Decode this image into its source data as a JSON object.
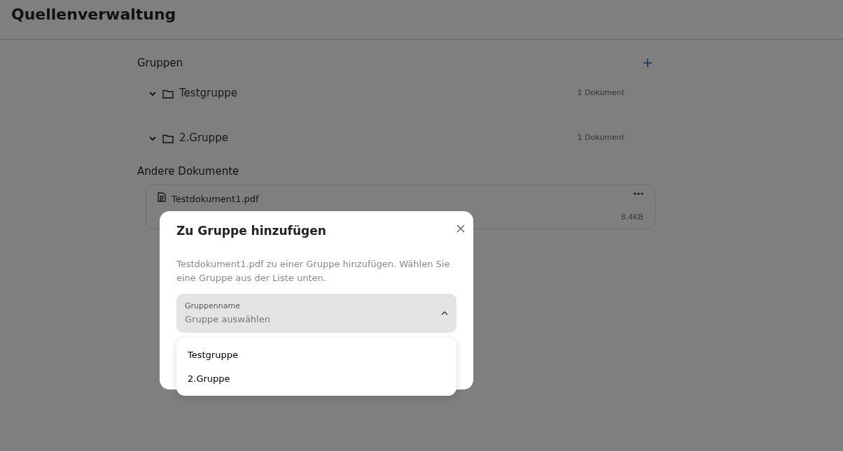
{
  "header": {
    "title": "Quellenverwaltung"
  },
  "groups": {
    "title": "Gruppen",
    "items": [
      {
        "name": "Testgruppe",
        "count": "1 Dokument",
        "expanded": false
      },
      {
        "name": "2.Gruppe",
        "count": "1 Dokument",
        "expanded": false
      }
    ]
  },
  "other_documents": {
    "title": "Andere Dokumente",
    "items": [
      {
        "name": "Testdokument1.pdf",
        "size": "8.4KB"
      }
    ]
  },
  "dialog": {
    "title": "Zu Gruppe hinzufügen",
    "description": "Testdokument1.pdf zu einer Gruppe hinzufügen. Wählen Sie eine Gruppe aus der Liste unten.",
    "select": {
      "label": "Gruppenname",
      "placeholder": "Gruppe auswählen",
      "expanded": true,
      "options": [
        {
          "label": "Testgruppe",
          "selected": false
        },
        {
          "label": "2.Gruppe",
          "selected": false
        }
      ]
    }
  }
}
